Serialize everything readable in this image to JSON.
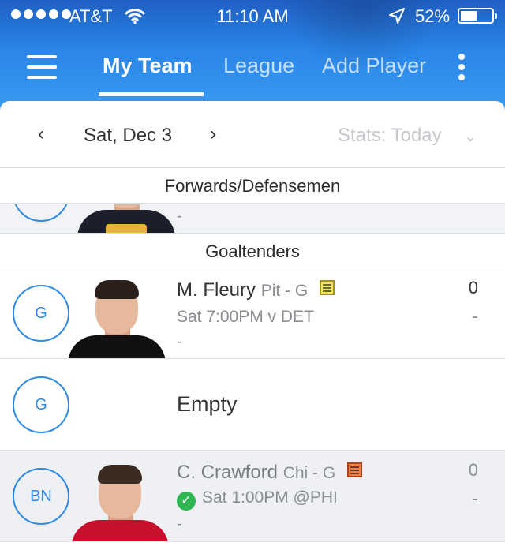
{
  "status_bar": {
    "carrier": "AT&T",
    "time": "11:10 AM",
    "battery_percent": "52%",
    "battery_level": 0.52,
    "icons": [
      "signal-dots",
      "wifi-icon",
      "location-arrow-icon",
      "battery-icon"
    ]
  },
  "nav": {
    "tabs": [
      {
        "label": "My Team",
        "active": true
      },
      {
        "label": "League",
        "active": false
      },
      {
        "label": "Add Player",
        "active": false
      }
    ],
    "icons": [
      "hamburger-menu-icon",
      "more-vertical-icon"
    ]
  },
  "date_bar": {
    "prev": "‹",
    "date": "Sat, Dec 3",
    "next": "›",
    "stats_filter": "Stats: Today",
    "stats_chevron": "⌄"
  },
  "sections": {
    "forwards_defensemen": {
      "title": "Forwards/Defensemen",
      "partial_row": {
        "dash": "-"
      }
    },
    "goaltenders": {
      "title": "Goaltenders",
      "rows": [
        {
          "position": "G",
          "name": "M. Fleury",
          "team_pos": "Pit - G",
          "note_color": "yellow",
          "game": "Sat 7:00PM v DET",
          "extra": "-",
          "stat": "0",
          "stat_sub": "-",
          "jersey_color": "#111111"
        },
        {
          "position": "G",
          "empty_label": "Empty"
        },
        {
          "position": "BN",
          "name": "C. Crawford",
          "team_pos": "Chi - G",
          "note_color": "orange",
          "check": "✓",
          "game": "Sat 1:00PM @PHI",
          "extra": "-",
          "stat": "0",
          "stat_sub": "-",
          "jersey_color": "#c8102e"
        }
      ]
    }
  },
  "colors": {
    "header_blue": "#2a86e8",
    "accent": "#2f8ae3",
    "check_green": "#2fb553",
    "bench_row": "#eef0f4",
    "divider": "#dcdfe4"
  }
}
